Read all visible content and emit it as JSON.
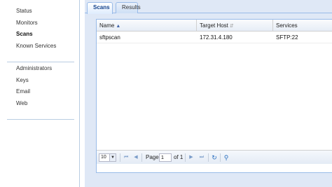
{
  "sidebar": {
    "group1": [
      "Status",
      "Monitors",
      "Scans",
      "Known Services"
    ],
    "group2": [
      "Administrators",
      "Keys",
      "Email",
      "Web"
    ],
    "active": "Scans"
  },
  "tabs": [
    "Scans",
    "Results"
  ],
  "grid": {
    "columns": [
      "Name",
      "Target Host",
      "Services"
    ],
    "rows": [
      [
        "sftpscan",
        "172.31.4.180",
        "SFTP:22"
      ]
    ]
  },
  "pager": {
    "page_size": "10",
    "page_label": "Page",
    "page_value": "1",
    "of_label": "of 1"
  }
}
